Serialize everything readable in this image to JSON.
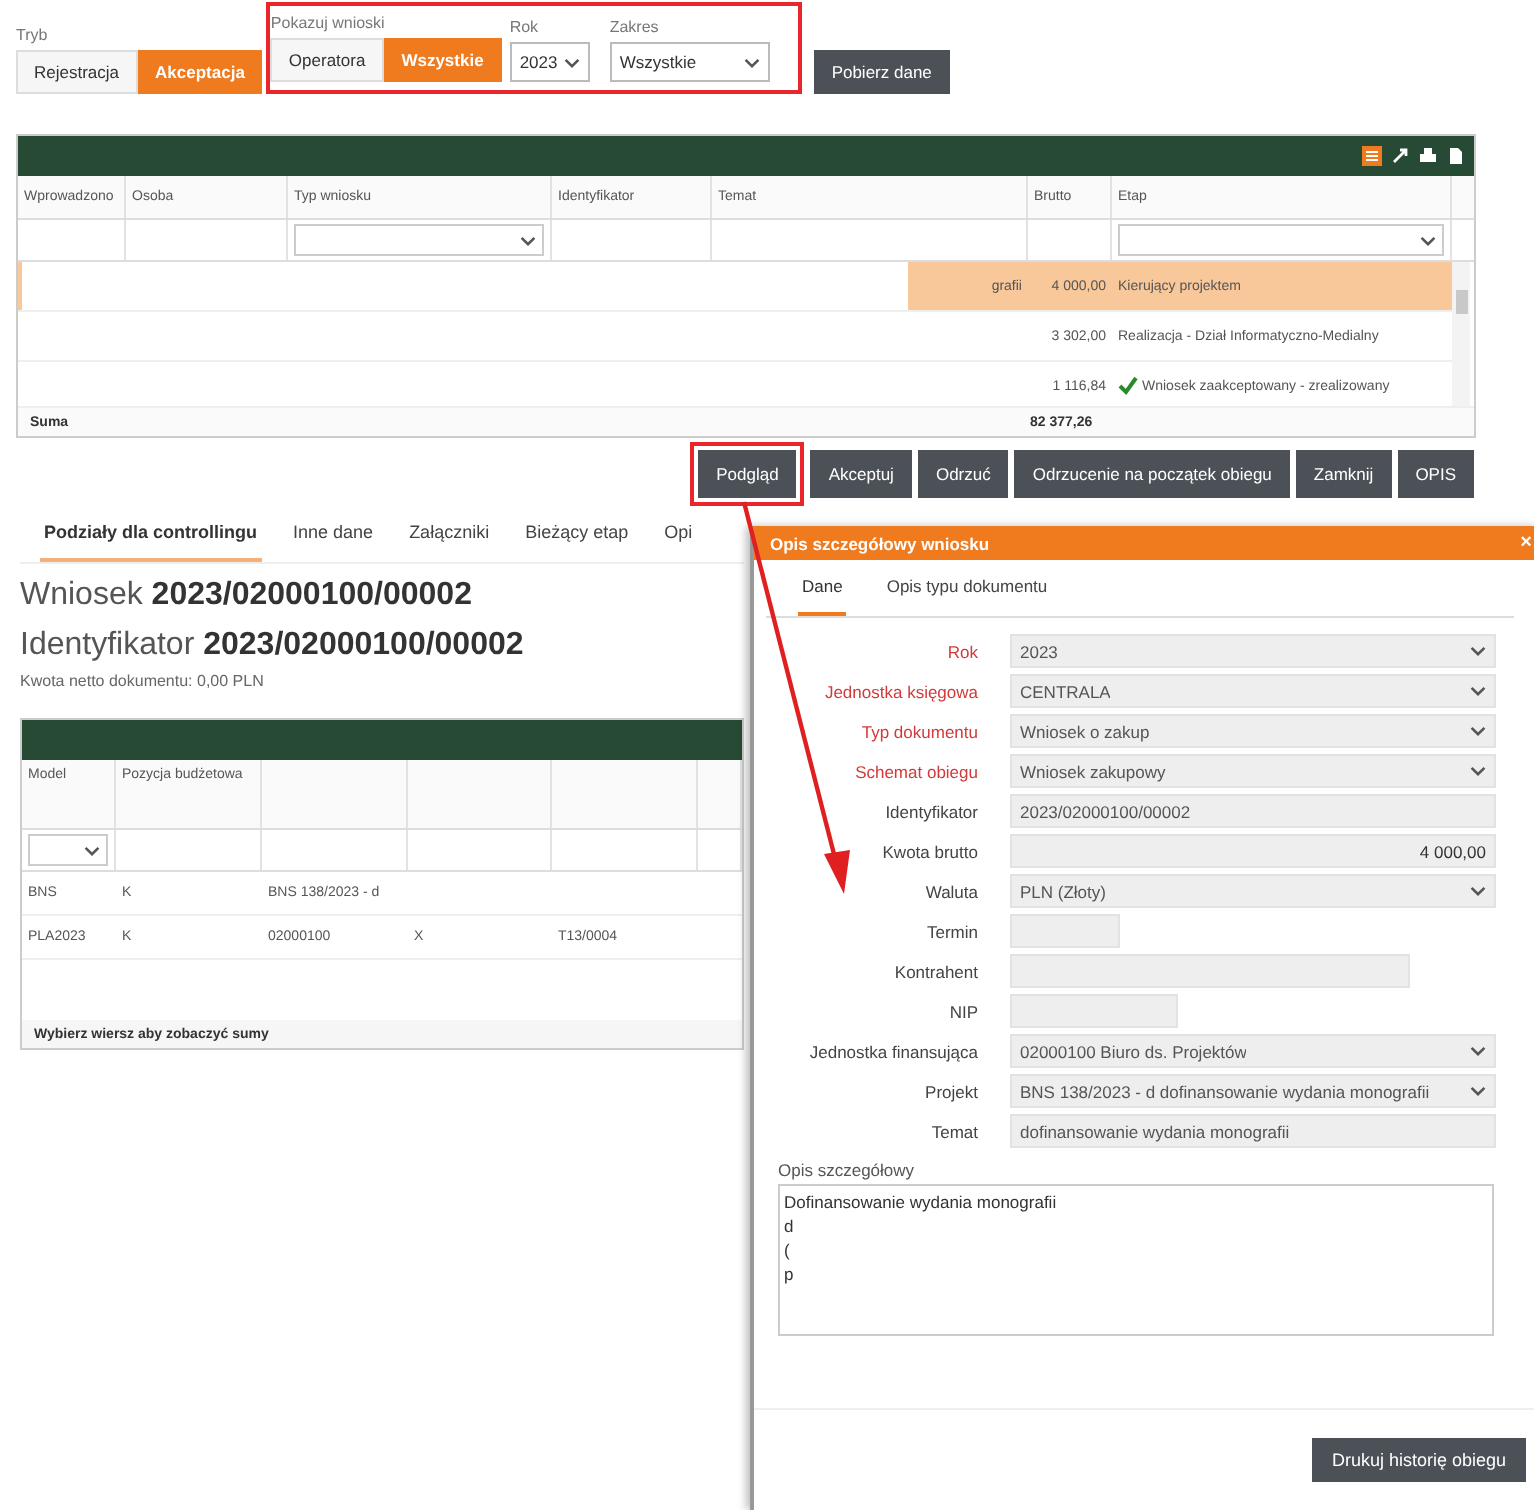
{
  "filters": {
    "highlighted": true,
    "mode": {
      "label": "Tryb",
      "options": [
        {
          "label": "Rejestracja",
          "selected": false
        },
        {
          "label": "Akceptacja",
          "selected": true
        }
      ]
    },
    "show": {
      "label": "Pokazuj wnioski",
      "options": [
        {
          "label": "Operatora",
          "selected": false
        },
        {
          "label": "Wszystkie",
          "selected": true
        }
      ]
    },
    "year": {
      "label": "Rok",
      "value": "2023"
    },
    "range": {
      "label": "Zakres",
      "value": "Wszystkie"
    },
    "fetch_button": "Pobierz dane"
  },
  "main_grid": {
    "columns": [
      "Wprowadzono",
      "Osoba",
      "Typ wniosku",
      "Identyfikator",
      "Temat",
      "Brutto",
      "Etap"
    ],
    "rows": [
      {
        "temat": "grafii",
        "brutto": "4 000,00",
        "etap": "Kierujący projektem",
        "accepted": false,
        "selected": true
      },
      {
        "brutto": "3 302,00",
        "etap": "Realizacja - Dział Informatyczno-Medialny",
        "accepted": false,
        "selected": false
      },
      {
        "brutto": "1 116,84",
        "etap": "Wniosek zaakceptowany - zrealizowany",
        "accepted": true,
        "selected": false
      }
    ],
    "sum_label": "Suma",
    "sum_value": "82 377,26"
  },
  "actions": [
    {
      "label": "Podgląd",
      "highlighted": true
    },
    {
      "label": "Akceptuj",
      "highlighted": false
    },
    {
      "label": "Odrzuć",
      "highlighted": false
    },
    {
      "label": "Odrzucenie na początek obiegu",
      "highlighted": false
    },
    {
      "label": "Zamknij",
      "highlighted": false
    },
    {
      "label": "OPIS",
      "highlighted": false
    }
  ],
  "detail": {
    "tabs": [
      {
        "label": "Podziały dla controllingu",
        "selected": true
      },
      {
        "label": "Inne dane",
        "selected": false
      },
      {
        "label": "Załączniki",
        "selected": false
      },
      {
        "label": "Bieżący etap",
        "selected": false
      },
      {
        "label": "Opi",
        "selected": false
      }
    ],
    "request_label": "Wniosek",
    "request_value": "2023/02000100/00002",
    "id_label": "Identyfikator",
    "id_value": "2023/02000100/00002",
    "net_amount": "Kwota netto dokumentu: 0,00 PLN",
    "grid": {
      "columns": [
        "Model",
        "Pozycja budżetowa"
      ],
      "rows": [
        [
          "BNS",
          "K",
          "BNS 138/2023 - d"
        ],
        [
          "PLA2023",
          "K",
          "02000100",
          "X",
          "T13/0004"
        ]
      ],
      "footer": "Wybierz wiersz aby zobaczyć sumy"
    }
  },
  "dialog": {
    "title": "Opis szczegółowy wniosku",
    "close": "×",
    "tabs": [
      {
        "label": "Dane",
        "selected": true
      },
      {
        "label": "Opis typu dokumentu",
        "selected": false
      }
    ],
    "fields": [
      {
        "label": "Rok",
        "value": "2023",
        "required": true,
        "kind": "select"
      },
      {
        "label": "Jednostka księgowa",
        "value": "CENTRALA",
        "required": true,
        "kind": "select"
      },
      {
        "label": "Typ dokumentu",
        "value": "Wniosek o zakup",
        "required": true,
        "kind": "select"
      },
      {
        "label": "Schemat obiegu",
        "value": "Wniosek zakupowy",
        "required": true,
        "kind": "select"
      },
      {
        "label": "Identyfikator",
        "value": "2023/02000100/00002",
        "required": false,
        "kind": "text"
      },
      {
        "label": "Kwota brutto",
        "value": "4 000,00",
        "required": false,
        "kind": "amount"
      },
      {
        "label": "Waluta",
        "value": "PLN (Złoty)",
        "required": false,
        "kind": "select"
      },
      {
        "label": "Termin",
        "required": false,
        "kind": "short"
      },
      {
        "label": "Kontrahent",
        "required": false,
        "kind": "medium"
      },
      {
        "label": "NIP",
        "required": false,
        "kind": "small"
      },
      {
        "label": "Jednostka finansująca",
        "value": "02000100 Biuro ds. Projektów",
        "required": false,
        "kind": "select"
      },
      {
        "label": "Projekt",
        "value": "BNS 138/2023 - d dofinansowanie wydania monografii",
        "required": false,
        "kind": "select"
      },
      {
        "label": "Temat",
        "value": "dofinansowanie wydania monografii",
        "required": false,
        "kind": "text"
      }
    ],
    "description_label": "Opis szczegółowy",
    "description": "Dofinansowanie wydania monografii\nd\n(\np",
    "print_button": "Drukuj historię obiegu"
  },
  "annotation_arrow": true
}
